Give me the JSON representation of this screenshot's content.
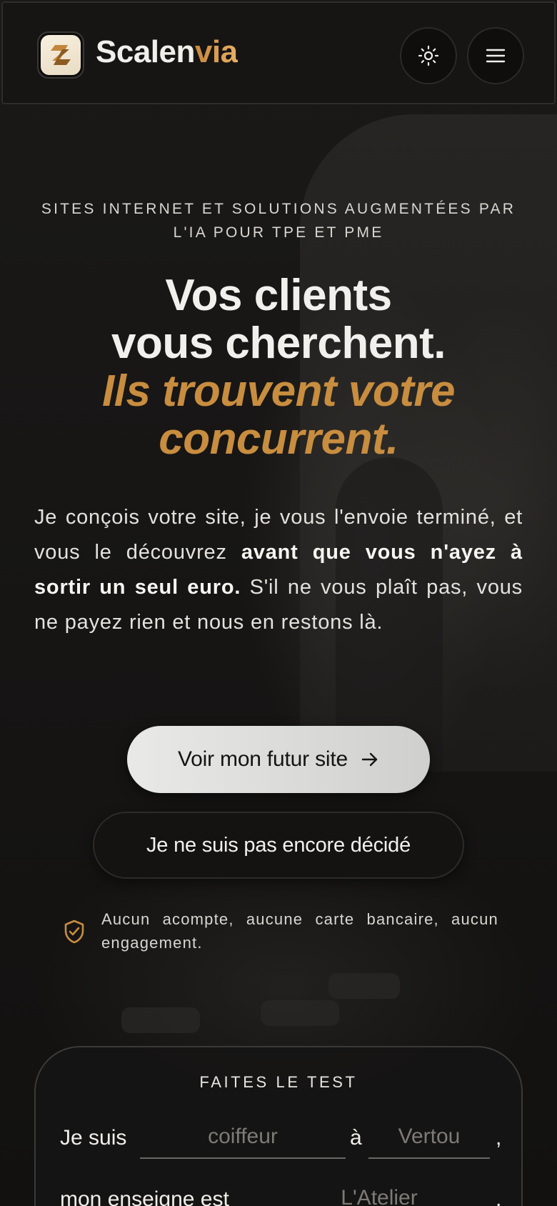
{
  "header": {
    "brand_main": "Scalen",
    "brand_accent": "via",
    "logo_icon": "scalenvia-logo-icon",
    "theme_toggle_icon": "sun-icon",
    "menu_icon": "hamburger-menu-icon"
  },
  "hero": {
    "eyebrow": "SITES INTERNET ET SOLUTIONS AUGMENTÉES PAR L'IA POUR TPE ET PME",
    "headline_line1": "Vos clients",
    "headline_line2": "vous cherchent.",
    "headline_gold": "Ils trouvent votre concurrent.",
    "lead_part1": "Je conçois votre site, je vous l'envoie terminé, et vous le découvrez ",
    "lead_bold": "avant que vous n'ayez à sortir un seul euro.",
    "lead_part2": " S'il ne vous plaît pas, vous ne payez rien et nous en restons là.",
    "primary_cta": "Voir mon futur site",
    "primary_cta_icon": "arrow-right-icon",
    "secondary_cta": "Je ne suis pas encore décidé",
    "assurance_icon": "shield-check-icon",
    "assurance_text": "Aucun acompte, aucune carte bancaire, aucun engagement."
  },
  "test": {
    "title": "FAITES LE TEST",
    "row1_prefix": "Je suis",
    "profession_placeholder": "coiffeur",
    "row1_connector": "à",
    "city_placeholder": "Vertou",
    "row1_suffix": ",",
    "row2_prefix": "mon enseigne est",
    "business_placeholder": "L'Atelier",
    "row2_suffix": ","
  },
  "colors": {
    "accent_gold": "#c88d3f",
    "background": "#151413",
    "primary_button": "#e3e3e1"
  }
}
